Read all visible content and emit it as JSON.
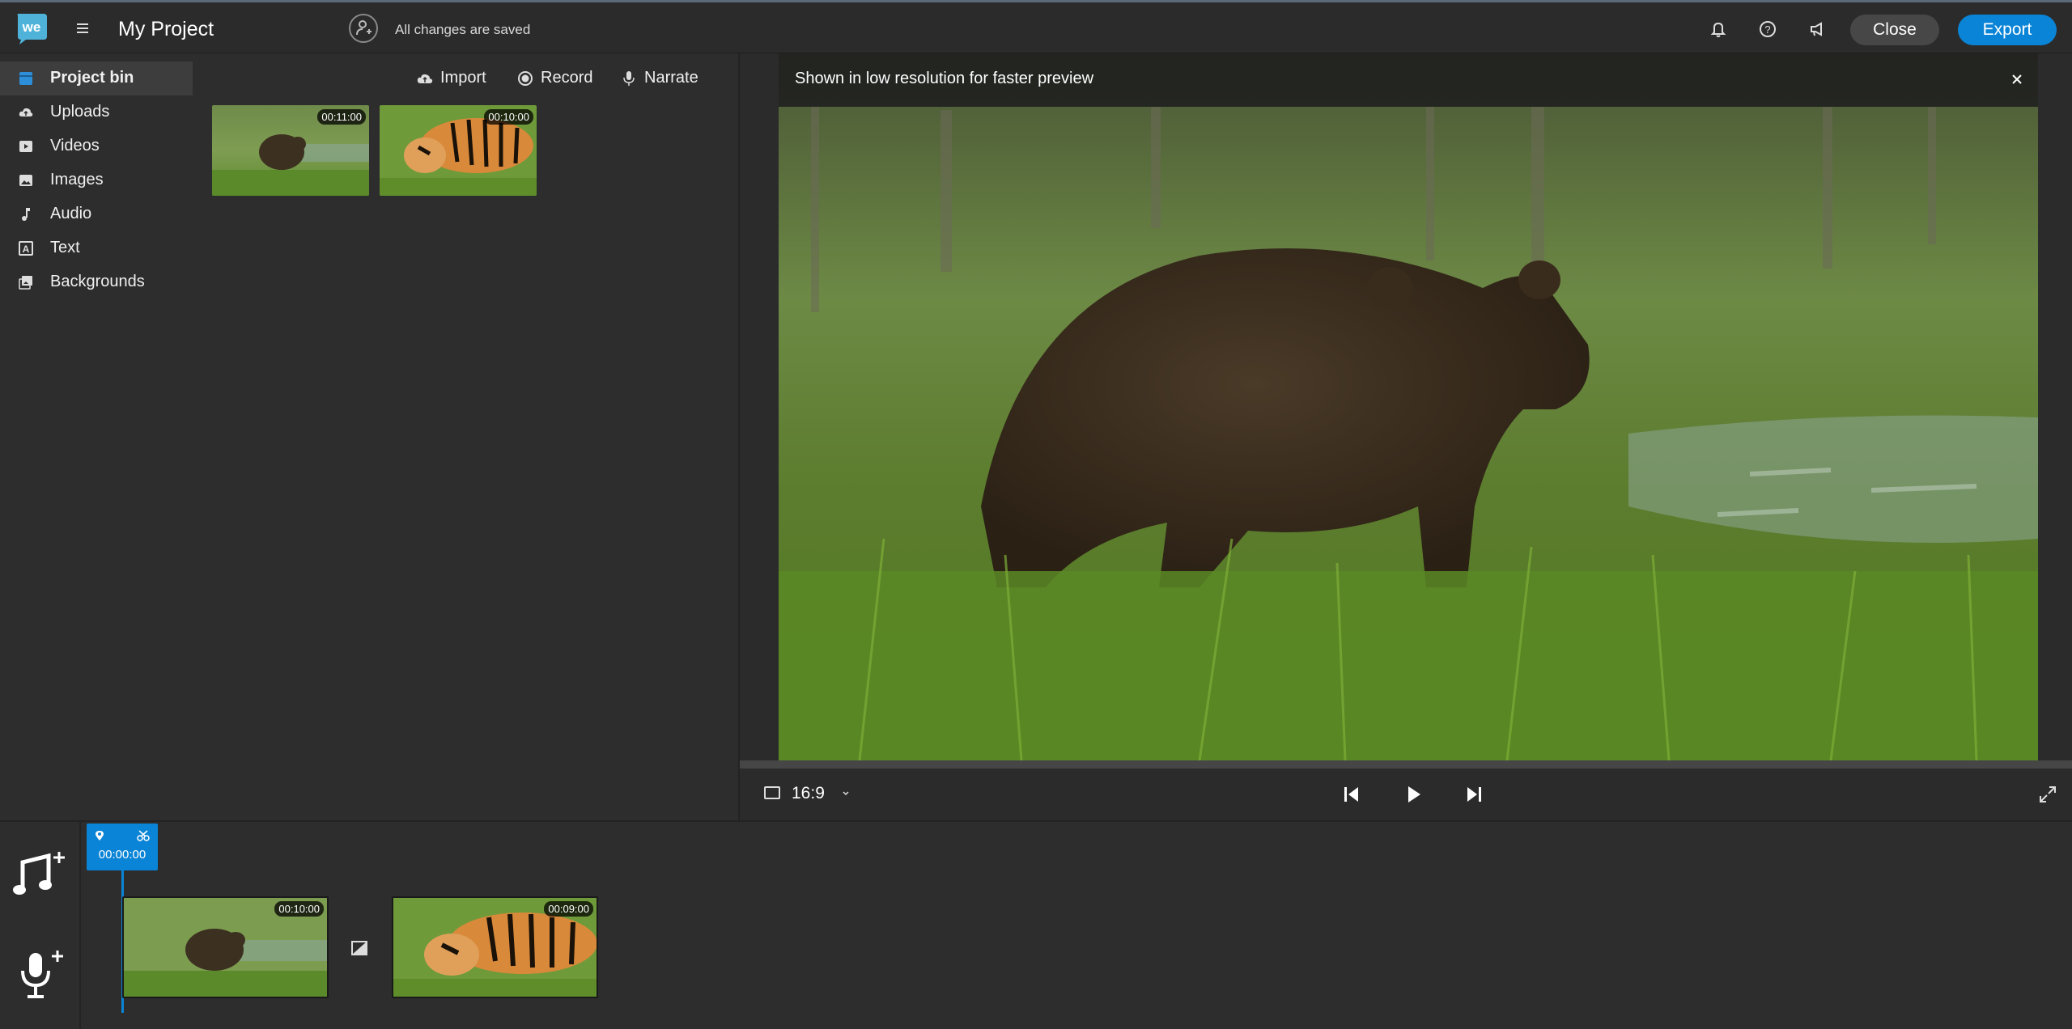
{
  "header": {
    "logo_text": "we",
    "title": "My Project",
    "save_status": "All changes are saved",
    "close_label": "Close",
    "export_label": "Export"
  },
  "sidebar": {
    "items": [
      {
        "label": "Project bin",
        "icon": "project-bin-icon",
        "active": true
      },
      {
        "label": "Uploads",
        "icon": "upload-cloud-icon"
      },
      {
        "label": "Videos",
        "icon": "video-icon"
      },
      {
        "label": "Images",
        "icon": "image-icon"
      },
      {
        "label": "Audio",
        "icon": "music-note-icon"
      },
      {
        "label": "Text",
        "icon": "text-icon"
      },
      {
        "label": "Backgrounds",
        "icon": "backgrounds-icon"
      }
    ]
  },
  "bin": {
    "import_label": "Import",
    "record_label": "Record",
    "narrate_label": "Narrate",
    "media": [
      {
        "name": "bear",
        "duration": "00:11:00"
      },
      {
        "name": "tiger",
        "duration": "00:10:00"
      }
    ]
  },
  "preview": {
    "banner_text": "Shown in low resolution for faster preview",
    "aspect_ratio": "16:9"
  },
  "timeline": {
    "playhead_time": "00:00:00",
    "clips": [
      {
        "name": "bear",
        "duration": "00:10:00"
      },
      {
        "name": "tiger",
        "duration": "00:09:00"
      }
    ]
  },
  "colors": {
    "accent": "#0a84d6",
    "background": "#2d2d2d"
  }
}
